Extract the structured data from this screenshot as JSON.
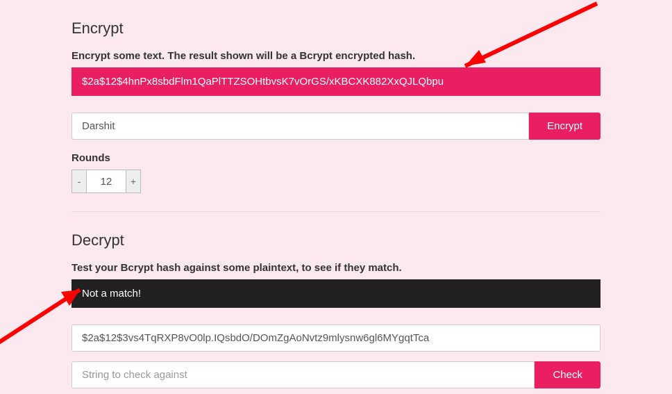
{
  "encrypt": {
    "title": "Encrypt",
    "desc": "Encrypt some text. The result shown will be a Bcrypt encrypted hash.",
    "result": "$2a$12$4hnPx8sbdFlm1QaPlTTZSOHtbvsK7vOrGS/xKBCXK882XxQJLQbpu",
    "input_value": "Darshit",
    "button": "Encrypt",
    "rounds_label": "Rounds",
    "rounds_minus": "-",
    "rounds_value": "12",
    "rounds_plus": "+"
  },
  "decrypt": {
    "title": "Decrypt",
    "desc": "Test your Bcrypt hash against some plaintext, to see if they match.",
    "result": "Not a match!",
    "hash_value": "$2a$12$3vs4TqRXP8vO0lp.IQsbdO/DOmZgAoNvtz9mlysnw6gl6MYgqtTca",
    "plaintext_placeholder": "String to check against",
    "button": "Check"
  }
}
